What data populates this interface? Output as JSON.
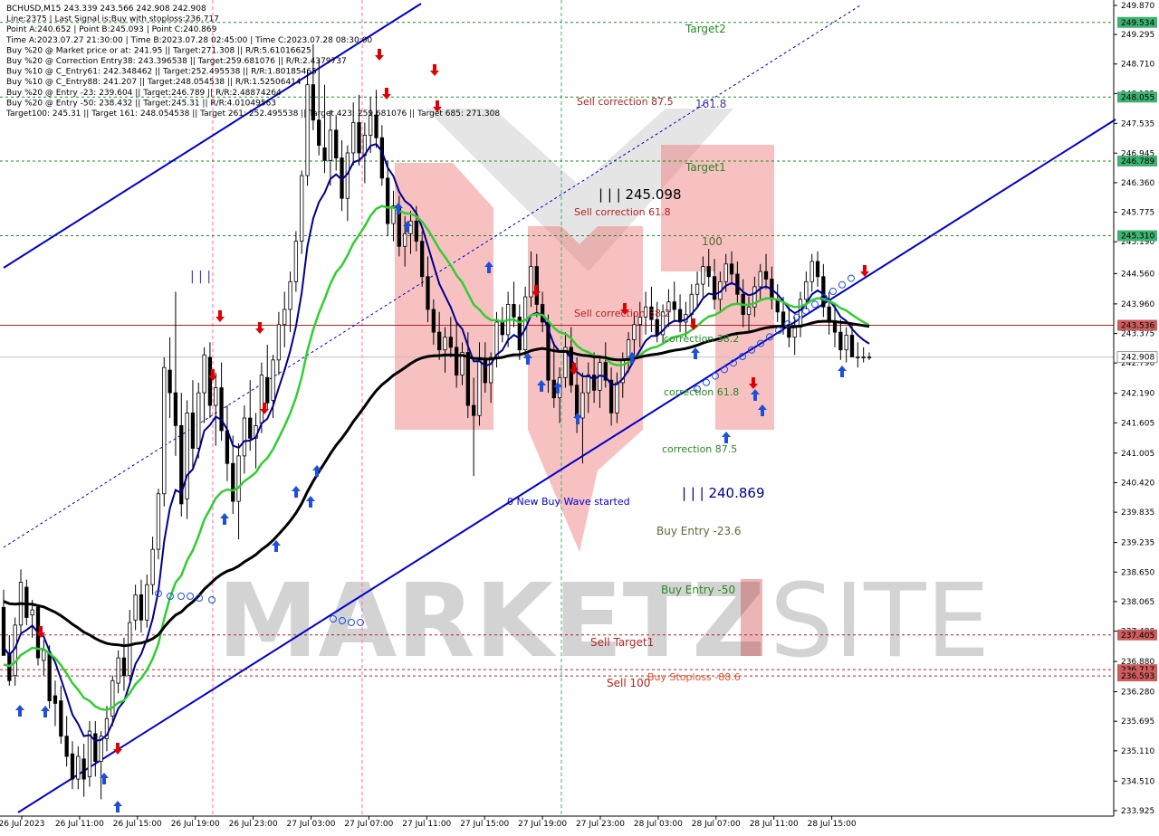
{
  "info_lines": [
    "BCHUSD,M15  243.339 243.566 242.908 242.908",
    "Line:2375 | Last Signal is:Buy with stoploss:236.717",
    "Point A:240.652 | Point B:245.093 | Point C:240.869",
    "Time A:2023.07.27 21:30:00 | Time B:2023.07.28 02:45:00 | Time C:2023.07.28 08:30:00",
    "Buy %20 @ Market price or at: 241.95 || Target:271.308 || R/R:5.61016625",
    "Buy %20 @ Correction Entry38: 243.396538 || Target:259.681076 || R/R:2.4379737",
    "Buy %10 @ C_Entry61: 242.348462 || Target:252.495538 || R/R:1.80185465",
    "Buy %10 @ C_Entry88: 241.207 || Target:248.054538 || R/R:1.52506414",
    "Buy %20 @ Entry -23: 239.604 || Target:246.789 || R/R:2.48874264",
    "Buy %20 @ Entry -50: 238.432 || Target:245.31 || R/R:4.01049563",
    "Target100: 245.31 || Target 161: 248.054538 || Target 261: 252.495538 || Target 423: 259.681076 || Target 685: 271.308"
  ],
  "watermark": {
    "left": "MARKETZ",
    "right": "SITE"
  },
  "colors": {
    "bg": "#ffffff",
    "candle": "#000000",
    "ma_fast": "#00008b",
    "ma_mid": "#32cd32",
    "ma_slow": "#000000",
    "channel": "#0000cd",
    "level_green": "#228b22",
    "level_red": "#b22222",
    "badge_green": "#3cb371",
    "badge_red": "#cd5c5c",
    "current": "#c0c0c0",
    "buy_arrow": "#1e4fd8",
    "sell_arrow": "#e00000",
    "vline_pink": "#ff69b4",
    "vline_green": "#3cb371"
  },
  "chart_data": {
    "type": "candlestick",
    "symbol": "BCHUSD",
    "timeframe": "M15",
    "ylim": [
      233.925,
      249.87
    ],
    "yticks": [
      "249.870",
      "249.295",
      "248.710",
      "248.125",
      "247.535",
      "246.945",
      "246.360",
      "245.775",
      "245.190",
      "244.560",
      "243.960",
      "243.375",
      "242.790",
      "242.190",
      "241.605",
      "241.005",
      "240.420",
      "239.835",
      "239.235",
      "238.650",
      "238.065",
      "237.480",
      "236.880",
      "236.280",
      "235.695",
      "235.110",
      "234.510",
      "233.925"
    ],
    "xticks": [
      "26 Jul 2023",
      "26 Jul 11:00",
      "26 Jul 15:00",
      "26 Jul 19:00",
      "26 Jul 23:00",
      "27 Jul 03:00",
      "27 Jul 07:00",
      "27 Jul 11:00",
      "27 Jul 15:00",
      "27 Jul 19:00",
      "27 Jul 23:00",
      "28 Jul 03:00",
      "28 Jul 07:00",
      "28 Jul 11:00",
      "28 Jul 15:00"
    ],
    "bar_count": 152,
    "candles": [
      [
        237.95,
        238.3,
        237.0,
        237.0
      ],
      [
        237.05,
        237.4,
        236.4,
        236.5
      ],
      [
        236.6,
        237.75,
        236.4,
        237.6
      ],
      [
        237.6,
        238.7,
        237.45,
        238.45
      ],
      [
        238.35,
        238.5,
        237.6,
        237.75
      ],
      [
        237.8,
        238.1,
        237.35,
        237.9
      ],
      [
        237.95,
        238.0,
        236.8,
        236.95
      ],
      [
        236.9,
        237.3,
        236.6,
        237.1
      ],
      [
        237.05,
        237.2,
        235.95,
        236.1
      ],
      [
        236.2,
        236.5,
        235.6,
        236.05
      ],
      [
        236.1,
        236.4,
        235.25,
        235.4
      ],
      [
        235.4,
        235.8,
        234.8,
        235.0
      ],
      [
        235.05,
        235.3,
        234.35,
        234.55
      ],
      [
        234.55,
        235.2,
        234.35,
        235.0
      ],
      [
        234.95,
        235.25,
        234.2,
        234.55
      ],
      [
        234.6,
        235.7,
        234.4,
        235.5
      ],
      [
        235.45,
        235.7,
        234.6,
        234.9
      ],
      [
        234.9,
        235.5,
        234.15,
        235.4
      ],
      [
        235.35,
        236.0,
        235.1,
        235.75
      ],
      [
        235.8,
        236.6,
        235.6,
        236.5
      ],
      [
        236.45,
        237.1,
        236.25,
        236.95
      ],
      [
        236.95,
        237.35,
        236.3,
        236.6
      ],
      [
        236.6,
        237.9,
        236.5,
        237.65
      ],
      [
        237.7,
        238.4,
        237.5,
        238.2
      ],
      [
        238.2,
        238.5,
        237.45,
        237.7
      ],
      [
        237.7,
        238.6,
        237.55,
        238.4
      ],
      [
        238.4,
        239.35,
        238.2,
        239.1
      ],
      [
        239.1,
        240.3,
        238.9,
        240.2
      ],
      [
        240.2,
        242.9,
        239.95,
        242.7
      ],
      [
        242.65,
        243.3,
        241.7,
        242.2
      ],
      [
        242.2,
        244.2,
        240.95,
        241.55
      ],
      [
        241.55,
        242.2,
        239.75,
        240.0
      ],
      [
        240.1,
        242.05,
        239.7,
        241.8
      ],
      [
        241.8,
        242.45,
        240.7,
        241.1
      ],
      [
        241.1,
        242.4,
        240.9,
        242.2
      ],
      [
        242.2,
        243.1,
        241.6,
        242.95
      ],
      [
        242.9,
        243.2,
        241.7,
        241.95
      ],
      [
        241.95,
        242.6,
        241.15,
        242.3
      ],
      [
        242.3,
        242.8,
        241.25,
        241.45
      ],
      [
        241.45,
        241.95,
        240.45,
        240.8
      ],
      [
        240.8,
        241.35,
        239.8,
        240.05
      ],
      [
        240.05,
        241.2,
        239.3,
        240.95
      ],
      [
        240.95,
        241.95,
        240.6,
        241.7
      ],
      [
        241.7,
        242.45,
        241.05,
        241.3
      ],
      [
        241.3,
        241.8,
        240.7,
        241.55
      ],
      [
        241.6,
        242.8,
        241.4,
        242.55
      ],
      [
        242.5,
        243.15,
        241.85,
        242.0
      ],
      [
        242.05,
        242.95,
        241.7,
        242.85
      ],
      [
        242.85,
        243.8,
        242.55,
        243.55
      ],
      [
        243.55,
        244.2,
        243.1,
        243.85
      ],
      [
        243.85,
        244.6,
        243.4,
        244.4
      ],
      [
        244.4,
        245.4,
        244.2,
        245.2
      ],
      [
        245.2,
        246.6,
        244.95,
        246.5
      ],
      [
        246.5,
        248.6,
        246.3,
        248.3
      ],
      [
        248.3,
        249.1,
        247.4,
        247.6
      ],
      [
        247.6,
        248.8,
        246.9,
        247.1
      ],
      [
        247.05,
        248.3,
        246.55,
        246.8
      ],
      [
        246.8,
        247.8,
        246.3,
        247.4
      ],
      [
        247.4,
        247.7,
        246.6,
        246.85
      ],
      [
        246.85,
        247.2,
        245.8,
        246.05
      ],
      [
        246.05,
        247.1,
        245.6,
        246.95
      ],
      [
        246.95,
        247.95,
        246.7,
        247.55
      ],
      [
        247.55,
        248.1,
        246.7,
        246.95
      ],
      [
        246.9,
        247.55,
        246.35,
        247.3
      ],
      [
        247.3,
        248.05,
        246.95,
        247.7
      ],
      [
        247.7,
        248.2,
        247.05,
        247.25
      ],
      [
        247.25,
        247.5,
        246.3,
        246.45
      ],
      [
        246.45,
        246.8,
        245.3,
        245.55
      ],
      [
        245.55,
        246.2,
        245.2,
        245.9
      ],
      [
        245.9,
        246.1,
        244.9,
        245.1
      ],
      [
        245.1,
        245.7,
        244.7,
        245.35
      ],
      [
        245.35,
        245.8,
        244.95,
        245.6
      ],
      [
        245.6,
        245.9,
        245.0,
        245.2
      ],
      [
        245.2,
        245.4,
        244.3,
        244.5
      ],
      [
        244.5,
        244.9,
        243.6,
        243.85
      ],
      [
        243.85,
        244.05,
        243.15,
        243.4
      ],
      [
        243.4,
        243.8,
        242.85,
        243.05
      ],
      [
        243.05,
        243.5,
        242.6,
        243.3
      ],
      [
        243.3,
        243.7,
        242.9,
        243.1
      ],
      [
        243.1,
        243.6,
        242.3,
        242.55
      ],
      [
        242.55,
        243.2,
        242.35,
        243.0
      ],
      [
        243.0,
        243.4,
        241.7,
        241.95
      ],
      [
        241.95,
        242.5,
        240.55,
        241.75
      ],
      [
        241.75,
        243.2,
        241.55,
        242.85
      ],
      [
        242.85,
        243.2,
        242.2,
        242.4
      ],
      [
        242.4,
        243.0,
        242.0,
        242.9
      ],
      [
        242.9,
        243.8,
        242.7,
        243.6
      ],
      [
        243.6,
        243.9,
        243.2,
        243.35
      ],
      [
        243.35,
        244.2,
        243.1,
        243.95
      ],
      [
        243.95,
        244.4,
        243.5,
        243.7
      ],
      [
        243.7,
        243.95,
        242.85,
        243.05
      ],
      [
        243.05,
        244.3,
        242.9,
        244.1
      ],
      [
        244.1,
        245.0,
        243.9,
        244.7
      ],
      [
        244.7,
        244.95,
        243.7,
        243.95
      ],
      [
        243.95,
        244.2,
        243.4,
        243.6
      ],
      [
        243.6,
        243.75,
        242.2,
        242.45
      ],
      [
        242.45,
        243.2,
        241.9,
        242.1
      ],
      [
        242.1,
        242.7,
        241.6,
        242.5
      ],
      [
        242.5,
        243.4,
        242.3,
        243.1
      ],
      [
        243.1,
        243.5,
        242.2,
        242.35
      ],
      [
        242.35,
        242.9,
        241.4,
        241.7
      ],
      [
        241.7,
        242.6,
        240.8,
        242.2
      ],
      [
        242.2,
        242.8,
        241.8,
        242.55
      ],
      [
        242.55,
        243.0,
        242.0,
        242.25
      ],
      [
        242.25,
        242.9,
        241.9,
        242.8
      ],
      [
        242.8,
        243.2,
        242.3,
        242.45
      ],
      [
        242.45,
        242.7,
        241.55,
        241.8
      ],
      [
        241.8,
        242.6,
        241.6,
        242.4
      ],
      [
        242.4,
        243.0,
        242.1,
        242.85
      ],
      [
        242.85,
        243.4,
        242.6,
        243.25
      ],
      [
        243.25,
        243.8,
        242.95,
        243.55
      ],
      [
        243.55,
        244.0,
        243.1,
        243.7
      ],
      [
        243.7,
        244.2,
        243.35,
        243.9
      ],
      [
        243.9,
        244.3,
        243.4,
        243.65
      ],
      [
        243.65,
        244.0,
        243.2,
        243.35
      ],
      [
        243.35,
        243.95,
        243.15,
        243.8
      ],
      [
        243.8,
        244.25,
        243.5,
        244.0
      ],
      [
        244.0,
        244.4,
        243.6,
        243.85
      ],
      [
        243.85,
        244.15,
        243.4,
        243.6
      ],
      [
        243.6,
        244.0,
        243.3,
        243.75
      ],
      [
        243.75,
        244.35,
        243.55,
        244.15
      ],
      [
        244.15,
        244.6,
        243.9,
        244.35
      ],
      [
        244.35,
        244.9,
        244.1,
        244.7
      ],
      [
        244.7,
        245.05,
        244.3,
        244.5
      ],
      [
        244.5,
        244.85,
        243.85,
        244.05
      ],
      [
        244.05,
        244.6,
        243.8,
        244.4
      ],
      [
        244.4,
        244.95,
        244.2,
        244.75
      ],
      [
        244.75,
        245.0,
        244.35,
        244.55
      ],
      [
        244.55,
        244.8,
        243.95,
        244.15
      ],
      [
        244.15,
        244.45,
        243.5,
        243.75
      ],
      [
        243.75,
        244.1,
        243.4,
        243.9
      ],
      [
        243.9,
        244.5,
        243.7,
        244.3
      ],
      [
        244.3,
        244.75,
        244.05,
        244.6
      ],
      [
        244.6,
        244.95,
        244.25,
        244.45
      ],
      [
        244.45,
        244.7,
        243.85,
        244.05
      ],
      [
        244.05,
        244.35,
        243.6,
        243.8
      ],
      [
        243.8,
        244.1,
        243.35,
        243.55
      ],
      [
        243.55,
        243.9,
        243.1,
        243.3
      ],
      [
        243.3,
        243.7,
        242.95,
        243.5
      ],
      [
        243.5,
        244.2,
        243.3,
        244.05
      ],
      [
        244.05,
        244.6,
        243.85,
        244.4
      ],
      [
        244.4,
        244.95,
        244.2,
        244.8
      ],
      [
        244.8,
        245.0,
        244.3,
        244.5
      ],
      [
        244.5,
        244.75,
        243.7,
        243.9
      ],
      [
        243.9,
        244.2,
        243.35,
        243.6
      ],
      [
        243.6,
        243.95,
        243.1,
        243.4
      ],
      [
        243.4,
        243.65,
        242.85,
        243.05
      ],
      [
        243.05,
        243.5,
        242.8,
        243.34
      ],
      [
        243.34,
        243.57,
        242.91,
        242.91
      ],
      [
        242.91,
        243.2,
        242.7,
        242.91
      ],
      [
        242.91,
        243.1,
        242.8,
        242.91
      ],
      [
        242.91,
        243.0,
        242.85,
        242.91
      ]
    ],
    "levels": [
      {
        "price": 249.534,
        "label": "249.534",
        "name": "Target2",
        "color": "green"
      },
      {
        "price": 248.055,
        "label": "248.055",
        "name": "",
        "color": "green"
      },
      {
        "price": 246.789,
        "label": "246.789",
        "name": "Target1",
        "color": "green"
      },
      {
        "price": 245.31,
        "label": "245.310",
        "name": "100",
        "color": "green"
      },
      {
        "price": 243.536,
        "label": "243.536",
        "name": "",
        "color": "red"
      },
      {
        "price": 237.405,
        "label": "237.405",
        "name": "Sell Target1",
        "color": "red"
      },
      {
        "price": 236.717,
        "label": "236.717",
        "name": "",
        "color": "red"
      },
      {
        "price": 236.593,
        "label": "236.593",
        "name": "Sell 100",
        "color": "red"
      }
    ],
    "current_price": {
      "value": 242.908,
      "label": "242.908"
    },
    "annotations": {
      "point_b": "| | | 245.098",
      "point_c": "| | | 240.869",
      "point_a": "| | |",
      "sell_correction_875": "Sell correction 87.5",
      "sell_correction_618": "Sell correction 61.8",
      "sell_correction_382": "Sell correction 38.2",
      "correction_382": "correction 38.2",
      "correction_618": "correction 61.8",
      "correction_875": "correction 87.5",
      "fib_1618": "161.8",
      "new_wave": "0 New Buy Wave started",
      "buy_entry_236": "Buy Entry -23.6",
      "buy_entry_50": "Buy Entry -50",
      "buy_stoploss": "Buy Stoploss -88.6"
    }
  }
}
